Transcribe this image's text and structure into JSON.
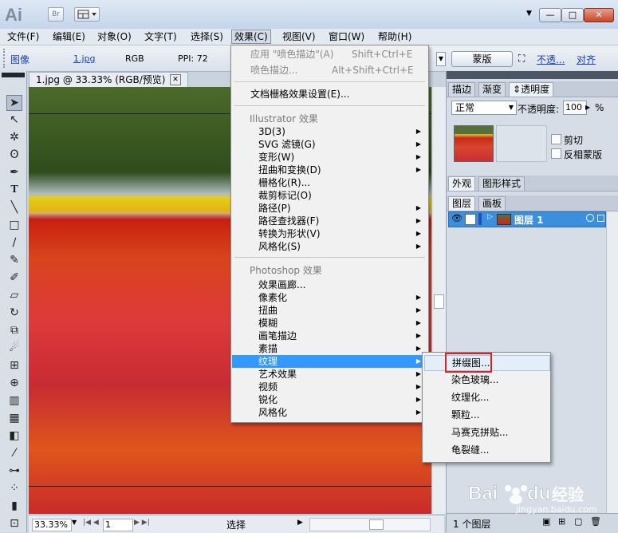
{
  "app": {
    "logo": "Ai",
    "bridge_label": "Br",
    "workspace_icon": "layout-icon"
  },
  "window_controls": {
    "minimize": "—",
    "restore": "□",
    "close": "✕"
  },
  "menubar": [
    {
      "label": "文件(F)"
    },
    {
      "label": "编辑(E)"
    },
    {
      "label": "对象(O)"
    },
    {
      "label": "文字(T)"
    },
    {
      "label": "选择(S)"
    },
    {
      "label": "效果(C)"
    },
    {
      "label": "视图(V)"
    },
    {
      "label": "窗口(W)"
    },
    {
      "label": "帮助(H)"
    }
  ],
  "control_bar": {
    "image_label": "图像",
    "file_link": "1.jpg",
    "color_mode": "RGB",
    "ppi": "PPI: 72",
    "mask_button": "蒙版",
    "opacity_link": "不透...",
    "align_link": "对齐"
  },
  "document": {
    "tab_title": "1.jpg @ 33.33% (RGB/预览)",
    "zoom": "33.33%",
    "page": "1",
    "status": "选择"
  },
  "effects_menu": {
    "apply_last": {
      "label": "应用 \"喷色描边\"(A)",
      "shortcut": "Shift+Ctrl+E"
    },
    "last_effect": {
      "label": "喷色描边...",
      "shortcut": "Alt+Shift+Ctrl+E"
    },
    "raster_settings": "文档栅格效果设置(E)...",
    "illustrator_header": "Illustrator 效果",
    "illustrator_items": [
      {
        "label": "3D(3)",
        "sub": true
      },
      {
        "label": "SVG 滤镜(G)",
        "sub": true
      },
      {
        "label": "变形(W)",
        "sub": true
      },
      {
        "label": "扭曲和变换(D)",
        "sub": true
      },
      {
        "label": "栅格化(R)...",
        "sub": false
      },
      {
        "label": "裁剪标记(O)",
        "sub": false
      },
      {
        "label": "路径(P)",
        "sub": true
      },
      {
        "label": "路径查找器(F)",
        "sub": true
      },
      {
        "label": "转换为形状(V)",
        "sub": true
      },
      {
        "label": "风格化(S)",
        "sub": true
      }
    ],
    "photoshop_header": "Photoshop 效果",
    "photoshop_items": [
      {
        "label": "效果画廊...",
        "sub": false
      },
      {
        "label": "像素化",
        "sub": true
      },
      {
        "label": "扭曲",
        "sub": true
      },
      {
        "label": "模糊",
        "sub": true
      },
      {
        "label": "画笔描边",
        "sub": true
      },
      {
        "label": "素描",
        "sub": true
      },
      {
        "label": "纹理",
        "sub": true,
        "highlighted": true
      },
      {
        "label": "艺术效果",
        "sub": true
      },
      {
        "label": "视频",
        "sub": true
      },
      {
        "label": "锐化",
        "sub": true
      },
      {
        "label": "风格化",
        "sub": true
      }
    ]
  },
  "texture_submenu": [
    "拼缀图...",
    "染色玻璃...",
    "纹理化...",
    "颗粒...",
    "马赛克拼贴...",
    "龟裂缝..."
  ],
  "transparency_panel": {
    "tabs": [
      "描边",
      "渐变",
      "透明度"
    ],
    "blend_mode": "正常",
    "opacity_label": "不透明度:",
    "opacity_value": "100",
    "opacity_unit": "%",
    "clip_label": "剪切",
    "invert_label": "反相蒙版"
  },
  "appearance_panel": {
    "tabs": [
      "外观",
      "图形样式"
    ]
  },
  "layers_panel": {
    "tabs": [
      "图层",
      "画板"
    ],
    "layer_name": "图层 1",
    "footer": "1 个图层"
  },
  "watermark": {
    "brand": "Bai du 经验",
    "url": "jingyan.baidu.com"
  },
  "colors": {
    "menu_highlight": "#3399ff",
    "callout": "#e02020",
    "layer_selected": "#3b8fdc"
  }
}
